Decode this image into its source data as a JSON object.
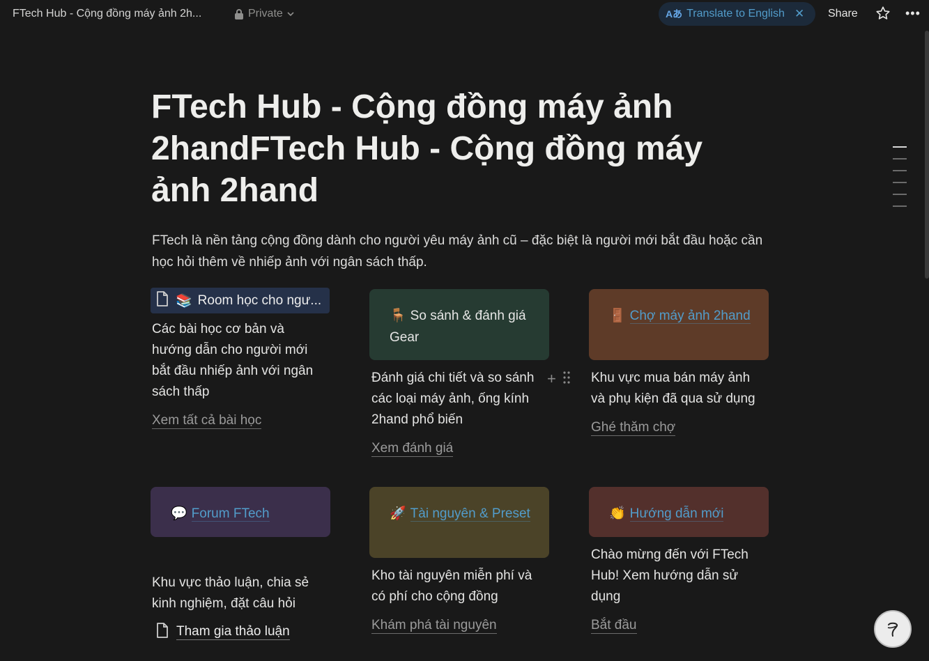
{
  "topbar": {
    "title": "FTech Hub - Cộng đồng máy ảnh 2h...",
    "privacy": "Private",
    "translate_label": "Translate to English",
    "translate_icon_text": "Aあ",
    "share": "Share"
  },
  "page": {
    "title": "FTech Hub - Cộng đồng máy ảnh 2handFTech Hub - Cộng đồng máy ảnh 2hand",
    "description": "FTech là nền tảng cộng đồng dành cho người yêu máy ảnh cũ – đặc biệt là người mới bắt đầu hoặc cần học hỏi thêm về nhiếp ảnh với ngân sách thấp."
  },
  "sections": [
    {
      "card_emoji": "📚",
      "card_label": "Room học cho ngư...",
      "description": "Các bài học cơ bản và hướng dẫn cho người mới bắt đầu nhiếp ảnh với ngân sách thấp",
      "link": "Xem tất cả bài học"
    },
    {
      "card_emoji": "🪑",
      "card_label": "So sánh & đánh giá Gear",
      "description": "Đánh giá chi tiết và so sánh các loại máy ảnh, ống kính 2hand phổ biến",
      "link": "Xem đánh giá",
      "card_color": "#263b32"
    },
    {
      "card_emoji": "🚪",
      "card_label": "Chợ máy ảnh 2hand",
      "description": "Khu vực mua bán máy ảnh và phụ kiện đã qua sử dụng",
      "link": "Ghé thăm chợ",
      "card_color": "#5e3b28"
    },
    {
      "card_emoji": "💬",
      "card_label": "Forum FTech",
      "description": "Khu vực thảo luận, chia sẻ kinh nghiệm, đặt câu hỏi",
      "link": "Tham gia thảo luận",
      "card_color": "#3b2f4b"
    },
    {
      "card_emoji": "🚀",
      "card_label": "Tài nguyên & Preset",
      "description": "Kho tài nguyên miễn phí và có phí cho cộng đồng",
      "link": "Khám phá tài nguyên",
      "card_color": "#4b4328"
    },
    {
      "card_emoji": "👏",
      "card_label": "Hướng dẫn mới",
      "description": "Chào mừng đến với FTech Hub! Xem hướng dẫn sử dụng",
      "link": "Bắt đầu",
      "card_color": "#53302c"
    }
  ],
  "colors": {
    "background": "#191919",
    "link_blue": "#529cca",
    "room_chip": "#253149"
  },
  "icons": [
    "lock-icon",
    "chevron-down-icon",
    "translate-icon",
    "close-icon",
    "star-icon",
    "more-icon",
    "page-icon",
    "plus-icon",
    "drag-handle-icon",
    "help-icon"
  ]
}
